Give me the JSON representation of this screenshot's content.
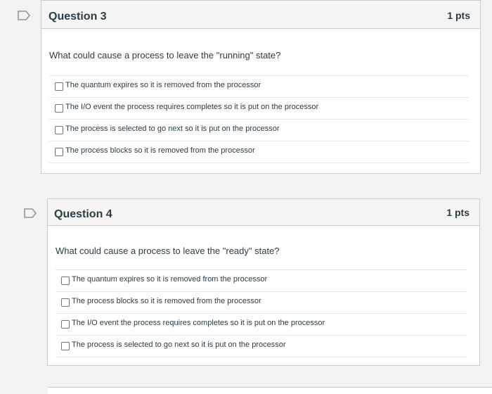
{
  "colors": {
    "flag": "#8b96a0",
    "border": "#c7cdd1",
    "header_bg": "#f5f5f5"
  },
  "questions": [
    {
      "title": "Question 3",
      "points": "1 pts",
      "text": "What could cause a process to leave the \"running\" state?",
      "flag_icon": "flag-outline-icon",
      "answers": [
        "The quantum expires so it is removed from the processor",
        "The I/O event the process requires completes so it is put on the processor",
        "The process is selected to go next so it is put on the processor",
        "The process blocks so it is removed from the processor"
      ]
    },
    {
      "title": "Question 4",
      "points": "1 pts",
      "text": "What could cause a process to leave the \"ready\" state?",
      "flag_icon": "flag-outline-icon",
      "answers": [
        "The quantum expires so it is removed from the processor",
        "The process blocks so it is removed from the processor",
        "The I/O event the process requires completes so it is put on the processor",
        "The process is selected to go next so it is put on the processor"
      ]
    }
  ]
}
